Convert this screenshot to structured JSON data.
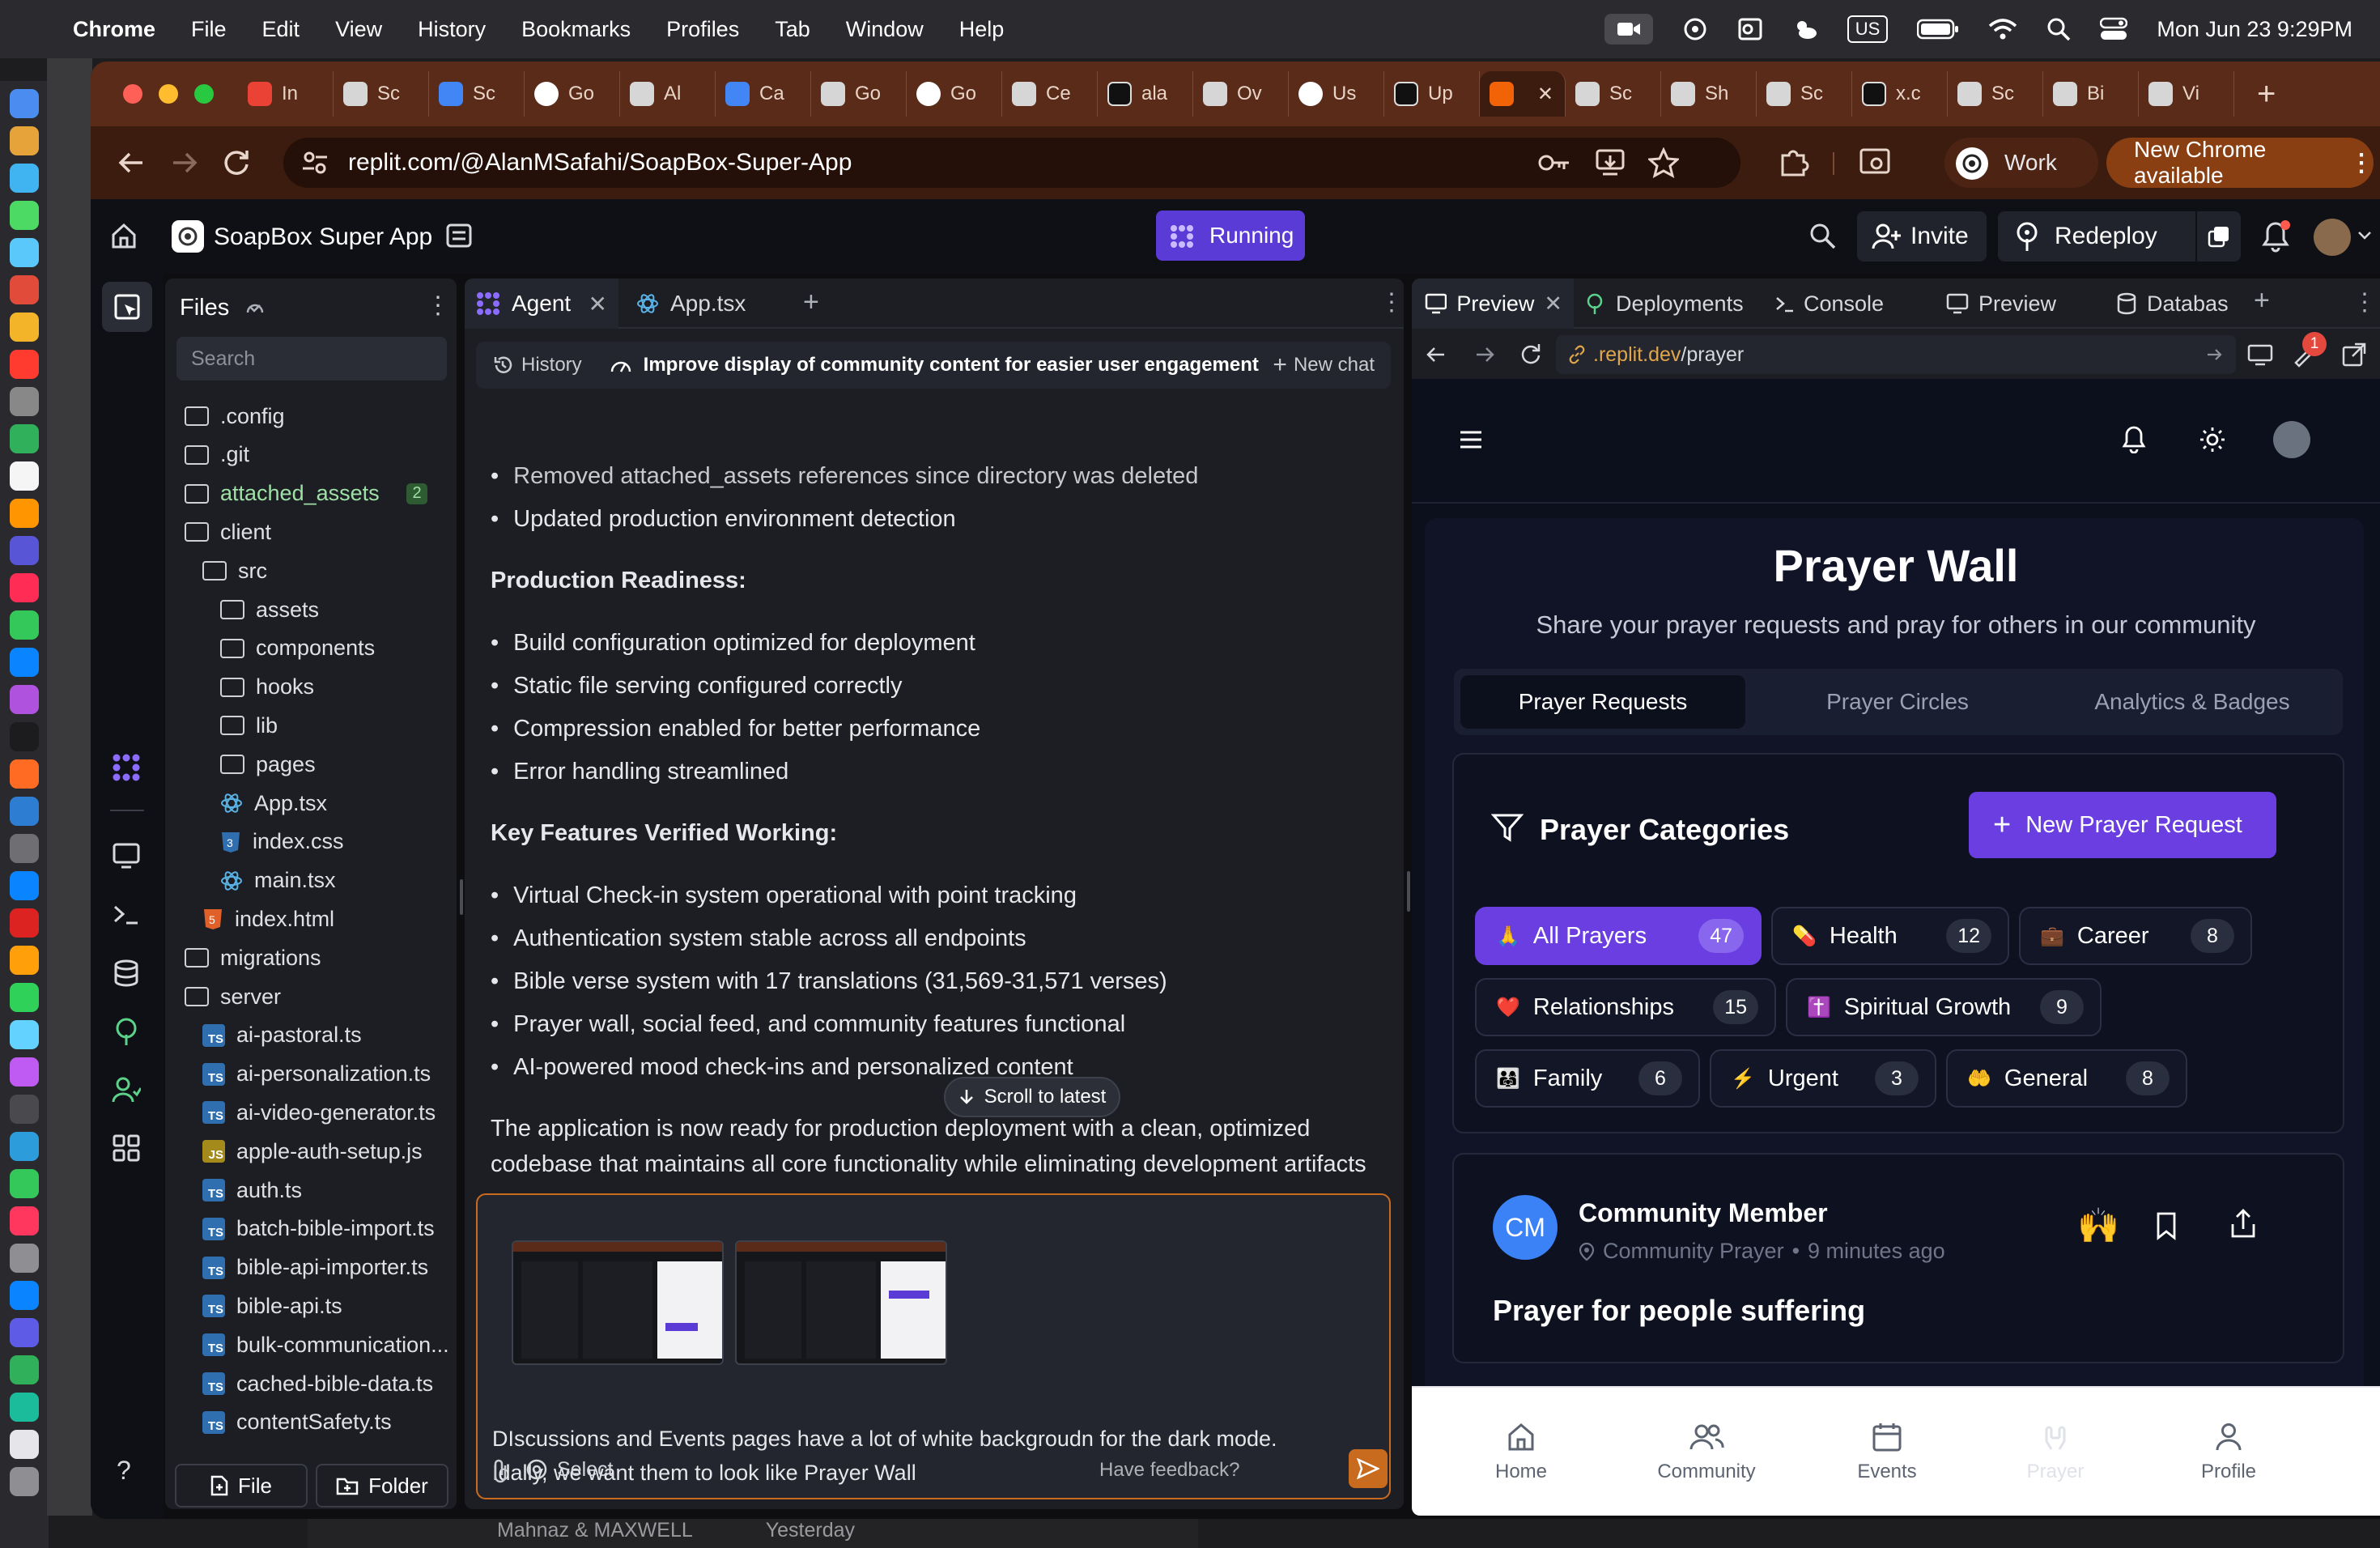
{
  "menubar": {
    "app": "Chrome",
    "items": [
      "File",
      "Edit",
      "View",
      "History",
      "Bookmarks",
      "Profiles",
      "Tab",
      "Window",
      "Help"
    ],
    "keyboard": "US",
    "datetime": "Mon Jun 23  9:29PM"
  },
  "tabs": [
    {
      "label": "In",
      "icon": "gmail-icon"
    },
    {
      "label": "Sc",
      "icon": "soapbox-icon"
    },
    {
      "label": "Sc",
      "icon": "docs-icon"
    },
    {
      "label": "Go",
      "icon": "google-icon"
    },
    {
      "label": "Al",
      "icon": "app-icon"
    },
    {
      "label": "Ca",
      "icon": "docs-icon"
    },
    {
      "label": "Go",
      "icon": "openai-icon"
    },
    {
      "label": "Go",
      "icon": "google-icon"
    },
    {
      "label": "Ce",
      "icon": "app-icon"
    },
    {
      "label": "ala",
      "icon": "github-icon"
    },
    {
      "label": "Ov",
      "icon": "app-icon"
    },
    {
      "label": "Us",
      "icon": "google-icon"
    },
    {
      "label": "Up",
      "icon": "github-icon"
    },
    {
      "label": "",
      "icon": "replit-icon",
      "active": true
    },
    {
      "label": "Sc",
      "icon": "soapbox-icon"
    },
    {
      "label": "Sh",
      "icon": "openai-icon"
    },
    {
      "label": "Sc",
      "icon": "soapbox-icon"
    },
    {
      "label": "x.c",
      "icon": "x-icon"
    },
    {
      "label": "Sc",
      "icon": "soapbox-icon"
    },
    {
      "label": "Bi",
      "icon": "app-icon"
    },
    {
      "label": "Vi",
      "icon": "app-icon"
    }
  ],
  "toolbar": {
    "url": "replit.com/@AlanMSafahi/SoapBox-Super-App",
    "profile": "Work",
    "update": "New Chrome available"
  },
  "replit": {
    "project": "SoapBox Super App",
    "status": "Running",
    "invite": "Invite",
    "redeploy": "Redeploy"
  },
  "files": {
    "title": "Files",
    "search_placeholder": "Search",
    "items": [
      {
        "name": ".config",
        "type": "folder",
        "depth": 0
      },
      {
        "name": ".git",
        "type": "folder",
        "depth": 0
      },
      {
        "name": "attached_assets",
        "type": "folder",
        "depth": 0,
        "badge": "2"
      },
      {
        "name": "client",
        "type": "folder",
        "depth": 0
      },
      {
        "name": "src",
        "type": "folder",
        "depth": 1
      },
      {
        "name": "assets",
        "type": "folder",
        "depth": 2
      },
      {
        "name": "components",
        "type": "folder",
        "depth": 2
      },
      {
        "name": "hooks",
        "type": "folder",
        "depth": 2
      },
      {
        "name": "lib",
        "type": "folder",
        "depth": 2
      },
      {
        "name": "pages",
        "type": "folder",
        "depth": 2
      },
      {
        "name": "App.tsx",
        "type": "react",
        "depth": 2
      },
      {
        "name": "index.css",
        "type": "css",
        "depth": 2
      },
      {
        "name": "main.tsx",
        "type": "react",
        "depth": 2
      },
      {
        "name": "index.html",
        "type": "html",
        "depth": 1
      },
      {
        "name": "migrations",
        "type": "folder",
        "depth": 0
      },
      {
        "name": "server",
        "type": "folder",
        "depth": 0
      },
      {
        "name": "ai-pastoral.ts",
        "type": "ts",
        "depth": 1
      },
      {
        "name": "ai-personalization.ts",
        "type": "ts",
        "depth": 1
      },
      {
        "name": "ai-video-generator.ts",
        "type": "ts",
        "depth": 1
      },
      {
        "name": "apple-auth-setup.js",
        "type": "js",
        "depth": 1
      },
      {
        "name": "auth.ts",
        "type": "ts",
        "depth": 1
      },
      {
        "name": "batch-bible-import.ts",
        "type": "ts",
        "depth": 1
      },
      {
        "name": "bible-api-importer.ts",
        "type": "ts",
        "depth": 1
      },
      {
        "name": "bible-api.ts",
        "type": "ts",
        "depth": 1
      },
      {
        "name": "bulk-communication...",
        "type": "ts",
        "depth": 1
      },
      {
        "name": "cached-bible-data.ts",
        "type": "ts",
        "depth": 1
      },
      {
        "name": "contentSafety.ts",
        "type": "ts",
        "depth": 1
      }
    ],
    "new_file": "File",
    "new_folder": "Folder"
  },
  "agent": {
    "tabs": [
      "Agent",
      "App.tsx"
    ],
    "history": "History",
    "thread_title": "Improve display of community content for easier user engagement",
    "new_chat": "New chat",
    "top_bullets": [
      "Removed attached_assets references since directory was deleted",
      "Updated production environment detection"
    ],
    "section1_title": "Production Readiness:",
    "section1_bullets": [
      "Build configuration optimized for deployment",
      "Static file serving configured correctly",
      "Compression enabled for better performance",
      "Error handling streamlined"
    ],
    "section2_title": "Key Features Verified Working:",
    "section2_bullets": [
      "Virtual Check-in system operational with point tracking",
      "Authentication system stable across all endpoints",
      "Bible verse system with 17 translations (31,569-31,571 verses)",
      "Prayer wall, social feed, and community features functional",
      "AI-powered mood check-ins and personalized content"
    ],
    "summary_line1": "The application is now ready for production deployment with a clean, optimized",
    "summary_line2": "codebase that maintains all core functionality while eliminating development artifacts",
    "scroll_latest": "Scroll to latest",
    "input_line1": "DIscussions and Events pages have a lot of white backgroudn for the dark mode.",
    "input_line2": "Idally, we want them to look like Prayer Wall",
    "select": "Select",
    "feedback": "Have feedback?"
  },
  "preview": {
    "tabs": [
      "Preview",
      "Deployments",
      "Console",
      "Preview",
      "Databas"
    ],
    "url_prefix": ".replit.dev",
    "url_path": "/prayer",
    "notification_count": "1",
    "page_title": "Prayer Wall",
    "page_subtitle": "Share your prayer requests and pray for others in our community",
    "segments": [
      "Prayer Requests",
      "Prayer Circles",
      "Analytics & Badges"
    ],
    "categories_title": "Prayer Categories",
    "new_request": "New Prayer Request",
    "categories": [
      {
        "emoji": "🙏",
        "label": "All Prayers",
        "count": "47",
        "active": true
      },
      {
        "emoji": "💊",
        "label": "Health",
        "count": "12"
      },
      {
        "emoji": "💼",
        "label": "Career",
        "count": "8"
      },
      {
        "emoji": "❤️",
        "label": "Relationships",
        "count": "15"
      },
      {
        "emoji": "✝️",
        "label": "Spiritual Growth",
        "count": "9"
      },
      {
        "emoji": "👨‍👩‍👧",
        "label": "Family",
        "count": "6"
      },
      {
        "emoji": "⚡",
        "label": "Urgent",
        "count": "3"
      },
      {
        "emoji": "🤲",
        "label": "General",
        "count": "8"
      }
    ],
    "post": {
      "initials": "CM",
      "author": "Community Member",
      "location": "Community Prayer",
      "time": "9 minutes ago",
      "title": "Prayer for people suffering"
    },
    "nav": [
      "Home",
      "Community",
      "Events",
      "Prayer",
      "Profile"
    ]
  },
  "background": {
    "chat_name": "Mahnaz & MAXWELL",
    "chat_time": "Yesterday"
  },
  "colors": {
    "accent": "#5b3bd6",
    "tabstrip": "#5a2b18",
    "app_bg": "#0c0f1c"
  }
}
